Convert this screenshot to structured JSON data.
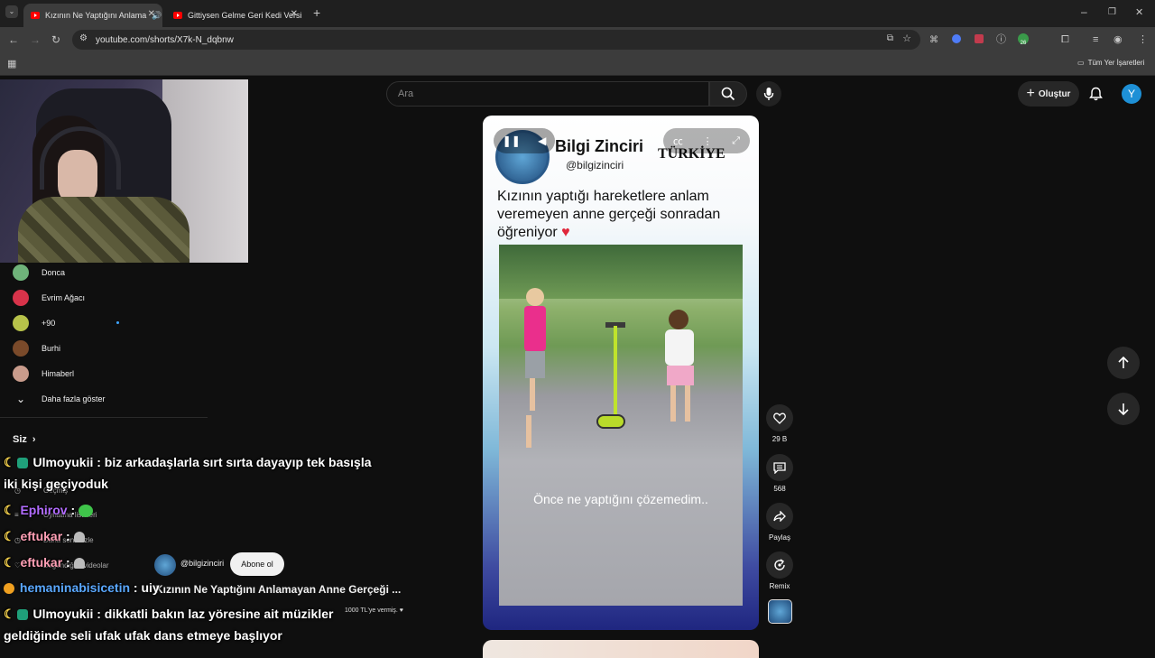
{
  "browser": {
    "tabs": [
      {
        "title": "Kızının Ne Yaptığını Anlama",
        "active": true
      },
      {
        "title": "Gittiysen Gelme Geri Kedi Versi",
        "active": false
      }
    ],
    "url": "youtube.com/shorts/X7k-N_dqbnw",
    "bookmarks_label": "Tüm Yer İşaretleri",
    "extension_badge": "26"
  },
  "header": {
    "search_placeholder": "Ara",
    "create_label": "Oluştur",
    "avatar_letter": "Y"
  },
  "sidebar": {
    "subscriptions": [
      {
        "label": "Donca",
        "color": "#6fb37a"
      },
      {
        "label": "Evrim Ağacı",
        "color": "#d8334a"
      },
      {
        "label": "+90",
        "color": "#b7c24a"
      },
      {
        "label": "Burhi",
        "color": "#7a4a2a"
      },
      {
        "label": "Himaberl",
        "color": "#c99c8c"
      }
    ],
    "show_more": "Daha fazla göster",
    "you_section": "Siz",
    "you_items": [
      "Geçmiş",
      "Oynatma listeleri",
      "Daha sonra izle",
      "Beğendiğim videolar"
    ]
  },
  "short": {
    "channel_name": "Bilgi Zinciri",
    "channel_handle": "@bilgizinciri",
    "country_tag": "TÜRKİYE",
    "title": "Kızının yaptığı hareketlere anlam veremeyen anne gerçeği sonradan öğreniyor",
    "subtitle": "Önce ne yaptığını çözemedim..",
    "bottom_channel": "@bilgizinciri",
    "subscribe_label": "Abone ol",
    "video_title": "Kızının Ne Yaptığını Anlamayan Anne Gerçeği ...",
    "thanks_text": "1000 TL'ye vermiş. ♥"
  },
  "actions": {
    "likes": "29 B",
    "comments": "568",
    "share": "Paylaş",
    "remix": "Remix"
  },
  "chat": [
    {
      "user": "Ulmoyukii",
      "color": "#ffffff",
      "text": " : biz arkadaşlarla sırt sırta dayayıp tek basışla"
    },
    {
      "user": "",
      "color": "#ffffff",
      "text": "iki kişi geçiyoduk"
    },
    {
      "user": "Ephirov",
      "color": "#b26cff",
      "text": " :"
    },
    {
      "user": "eftukar",
      "color": "#ff9fb5",
      "text": " :"
    },
    {
      "user": "eftukar",
      "color": "#ff9fb5",
      "text": " :"
    },
    {
      "user": "hemaninabisicetin",
      "color": "#5aa8ff",
      "text": " : uiy"
    },
    {
      "user": "Ulmoyukii",
      "color": "#ffffff",
      "text": " : dikkatli bakın laz yöresine ait müzikler"
    },
    {
      "user": "",
      "color": "#ffffff",
      "text": "geldiğinde seli ufak ufak dans etmeye başlıyor"
    }
  ]
}
